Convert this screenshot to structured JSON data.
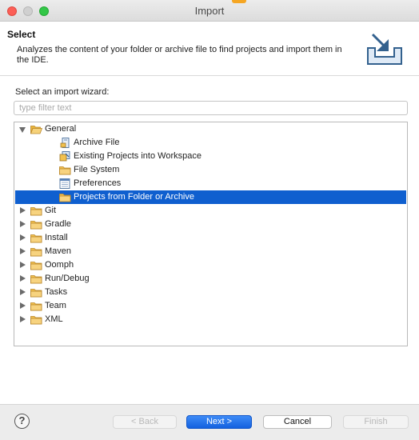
{
  "window": {
    "title": "Import"
  },
  "header": {
    "title": "Select",
    "description": "Analyzes the content of your folder or archive file to find projects and import them in the IDE."
  },
  "content": {
    "wizard_label": "Select an import wizard:",
    "filter_placeholder": "type filter text",
    "tree": [
      {
        "label": "General",
        "icon": "folder-open-icon",
        "level": 0,
        "expanded": true,
        "selected": false
      },
      {
        "label": "Archive File",
        "icon": "archive-file-icon",
        "level": 1,
        "selected": false
      },
      {
        "label": "Existing Projects into Workspace",
        "icon": "existing-projects-icon",
        "level": 1,
        "selected": false
      },
      {
        "label": "File System",
        "icon": "folder-icon",
        "level": 1,
        "selected": false
      },
      {
        "label": "Preferences",
        "icon": "preferences-icon",
        "level": 1,
        "selected": false
      },
      {
        "label": "Projects from Folder or Archive",
        "icon": "folder-icon",
        "level": 1,
        "selected": true
      },
      {
        "label": "Git",
        "icon": "folder-icon",
        "level": 0,
        "expanded": false,
        "selected": false
      },
      {
        "label": "Gradle",
        "icon": "folder-icon",
        "level": 0,
        "expanded": false,
        "selected": false
      },
      {
        "label": "Install",
        "icon": "folder-icon",
        "level": 0,
        "expanded": false,
        "selected": false
      },
      {
        "label": "Maven",
        "icon": "folder-icon",
        "level": 0,
        "expanded": false,
        "selected": false
      },
      {
        "label": "Oomph",
        "icon": "folder-icon",
        "level": 0,
        "expanded": false,
        "selected": false
      },
      {
        "label": "Run/Debug",
        "icon": "folder-icon",
        "level": 0,
        "expanded": false,
        "selected": false
      },
      {
        "label": "Tasks",
        "icon": "folder-icon",
        "level": 0,
        "expanded": false,
        "selected": false
      },
      {
        "label": "Team",
        "icon": "folder-icon",
        "level": 0,
        "expanded": false,
        "selected": false
      },
      {
        "label": "XML",
        "icon": "folder-icon",
        "level": 0,
        "expanded": false,
        "selected": false
      }
    ]
  },
  "footer": {
    "help_label": "?",
    "back_label": "< Back",
    "next_label": "Next >",
    "cancel_label": "Cancel",
    "finish_label": "Finish"
  },
  "colors": {
    "selection": "#0f5fcf",
    "accent": "#1461df",
    "folder": "#f2c14e"
  }
}
